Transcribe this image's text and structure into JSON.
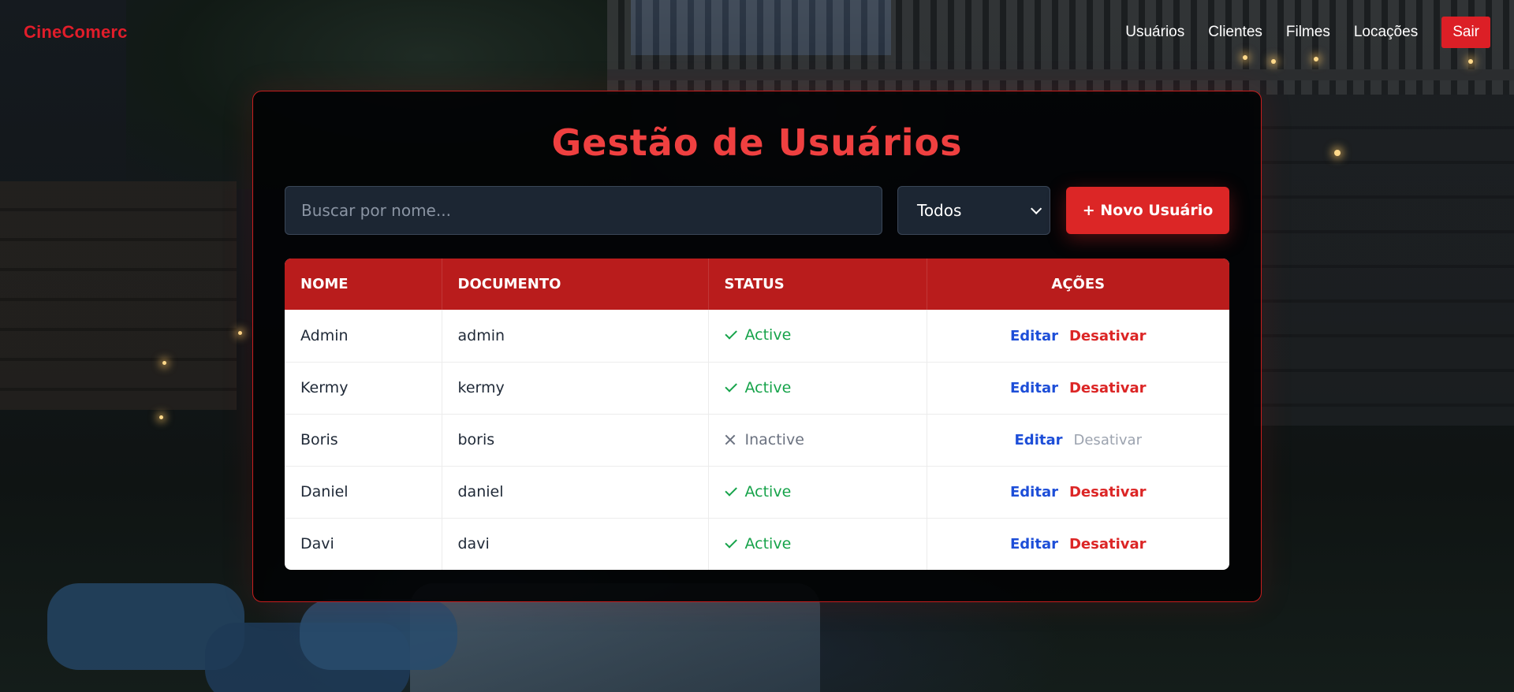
{
  "nav": {
    "brand": "CineComerc",
    "links": [
      "Usuários",
      "Clientes",
      "Filmes",
      "Locações"
    ],
    "logout_label": "Sair"
  },
  "page": {
    "title": "Gestão de Usuários"
  },
  "search": {
    "placeholder": "Buscar por nome...",
    "value": ""
  },
  "filter": {
    "selected": "Todos"
  },
  "new_user_label": "+ Novo Usuário",
  "table": {
    "headers": [
      "NOME",
      "DOCUMENTO",
      "STATUS",
      "AÇÕES"
    ],
    "rows": [
      {
        "nome": "Admin",
        "documento": "admin",
        "status": "Active"
      },
      {
        "nome": "Kermy",
        "documento": "kermy",
        "status": "Active"
      },
      {
        "nome": "Boris",
        "documento": "boris",
        "status": "Inactive"
      },
      {
        "nome": "Daniel",
        "documento": "daniel",
        "status": "Active"
      },
      {
        "nome": "Davi",
        "documento": "davi",
        "status": "Active"
      }
    ],
    "action_edit": "Editar",
    "action_disable": "Desativar"
  },
  "colors": {
    "brand": "#e11d2a",
    "title": "#ef4040",
    "header_bg": "#b91c1c",
    "active": "#16a34a",
    "inactive": "#6b7280",
    "edit": "#1d4ed8",
    "disable": "#dc2626"
  },
  "icons": {
    "active_status": "check-icon",
    "inactive_status": "close-icon",
    "filter": "chevron-down-icon"
  }
}
